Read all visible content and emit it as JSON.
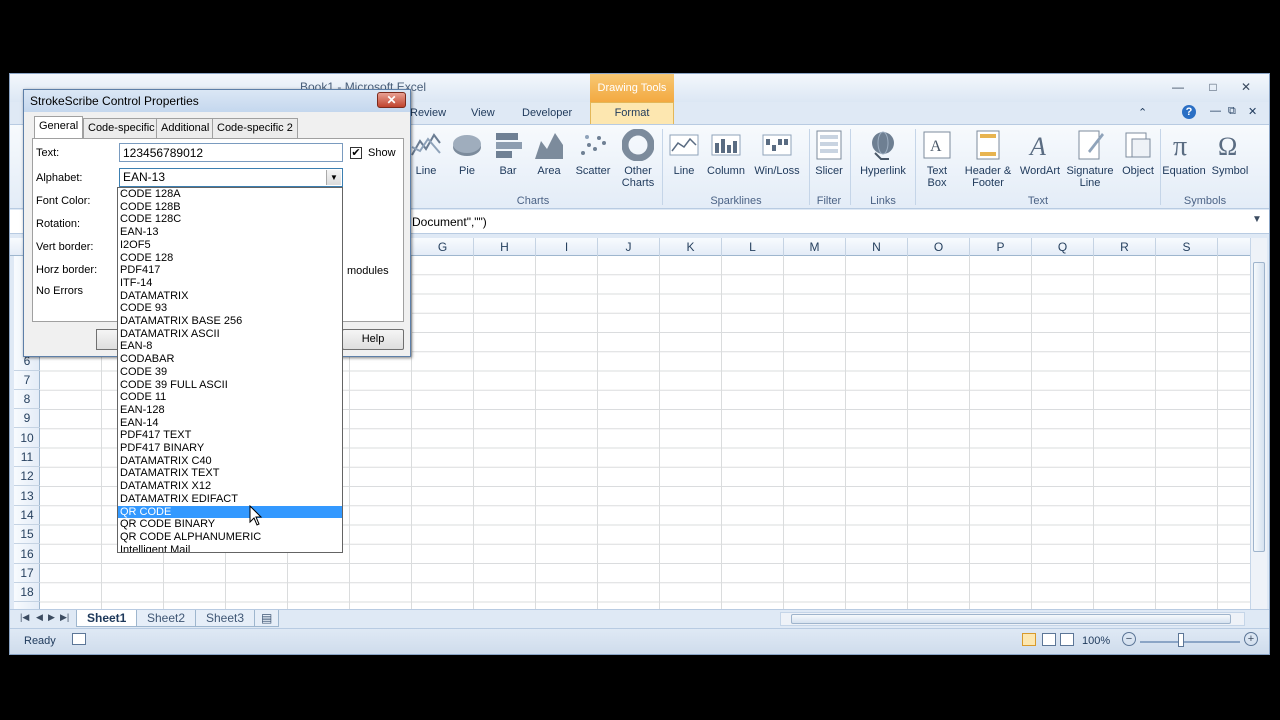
{
  "excel": {
    "title": "Book1 - Microsoft Excel",
    "contextual_tab": "Drawing Tools",
    "tabs": [
      "Review",
      "View",
      "Developer",
      "Format"
    ],
    "ribbon": {
      "charts_group": "Charts",
      "charts": [
        "Line",
        "Pie",
        "Bar",
        "Area",
        "Scatter",
        "Other Charts"
      ],
      "sparklines_group": "Sparklines",
      "sparklines": [
        "Line",
        "Column",
        "Win/Loss"
      ],
      "filter_group": "Filter",
      "filter": [
        "Slicer"
      ],
      "links_group": "Links",
      "links": [
        "Hyperlink"
      ],
      "text_group": "Text",
      "text": [
        "Text Box",
        "Header & Footer",
        "WordArt",
        "Signature Line",
        "Object"
      ],
      "symbols_group": "Symbols",
      "symbols": [
        "Equation",
        "Symbol"
      ]
    },
    "formula": "Document\",\"\")",
    "columns": [
      "G",
      "H",
      "I",
      "J",
      "K",
      "L",
      "M",
      "N",
      "O",
      "P",
      "Q",
      "R",
      "S"
    ],
    "rows": [
      "6",
      "7",
      "8",
      "9",
      "10",
      "11",
      "12",
      "13",
      "14",
      "15",
      "16",
      "17",
      "18"
    ],
    "sheets": [
      "Sheet1",
      "Sheet2",
      "Sheet3"
    ],
    "status": "Ready",
    "zoom": "100%"
  },
  "dialog": {
    "title": "StrokeScribe Control Properties",
    "close_label": "✕",
    "tabs": [
      "General",
      "Code-specific",
      "Additional",
      "Code-specific 2"
    ],
    "labels": {
      "text": "Text:",
      "alphabet": "Alphabet:",
      "font_color": "Font Color:",
      "rotation": "Rotation:",
      "vert_border": "Vert border:",
      "horz_border": "Horz border:",
      "no_errors": "No Errors",
      "modules": "modules",
      "show": "Show"
    },
    "text_value": "123456789012",
    "alphabet_value": "EAN-13",
    "help_label": "Help"
  },
  "dropdown": {
    "options": [
      "CODE 128A",
      "CODE 128B",
      "CODE 128C",
      "EAN-13",
      "I2OF5",
      "CODE 128",
      "PDF417",
      "ITF-14",
      "DATAMATRIX",
      "CODE 93",
      "DATAMATRIX BASE 256",
      "DATAMATRIX ASCII",
      "EAN-8",
      "CODABAR",
      "CODE 39",
      "CODE 39 FULL ASCII",
      "CODE 11",
      "EAN-128",
      "EAN-14",
      "PDF417 TEXT",
      "PDF417 BINARY",
      "DATAMATRIX C40",
      "DATAMATRIX TEXT",
      "DATAMATRIX X12",
      "DATAMATRIX EDIFACT",
      "QR CODE",
      "QR CODE BINARY",
      "QR CODE ALPHANUMERIC",
      "Intelligent Mail"
    ],
    "selected": "QR CODE"
  }
}
